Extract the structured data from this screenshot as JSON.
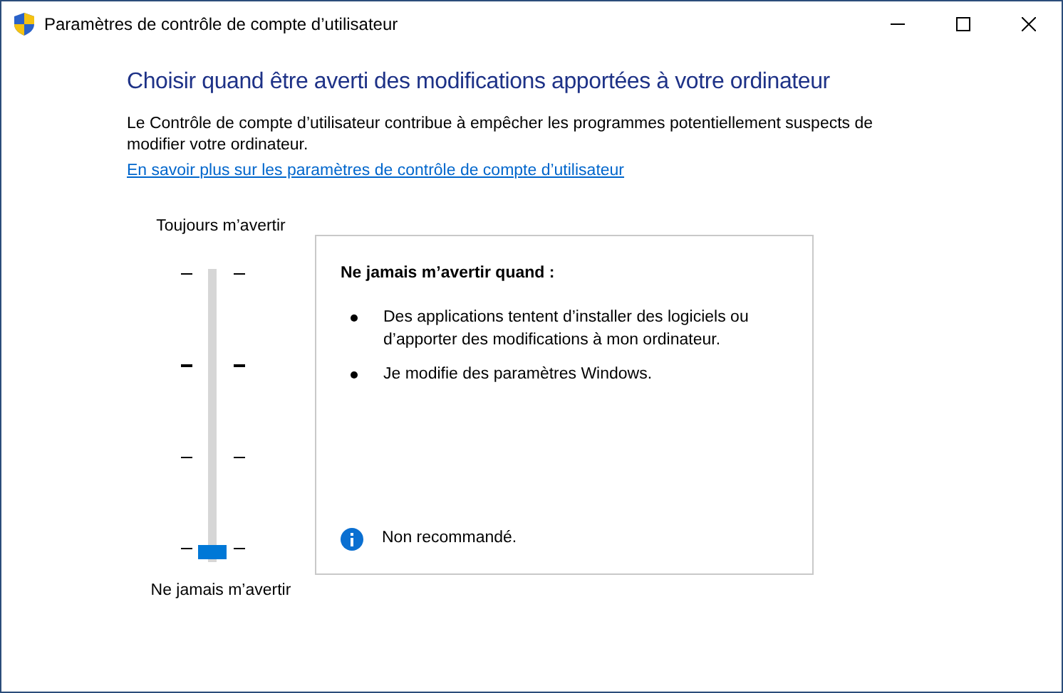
{
  "window": {
    "title": "Paramètres de contrôle de compte d’utilisateur"
  },
  "heading": "Choisir quand être averti des modifications apportées à votre ordinateur",
  "description": "Le Contrôle de compte d’utilisateur contribue à empêcher les programmes potentiellement suspects de modifier votre ordinateur.",
  "learn_more_link": "En savoir plus sur les paramètres de contrôle de compte d’utilisateur",
  "slider": {
    "top_label": "Toujours m’avertir",
    "bottom_label": "Ne jamais m’avertir",
    "level": 0
  },
  "info_panel": {
    "title": "Ne jamais m’avertir quand :",
    "bullets": [
      "Des applications tentent d’installer des logiciels ou d’apporter des modifications à mon ordinateur.",
      "Je modifie des paramètres Windows."
    ],
    "note": "Non recommandé."
  }
}
